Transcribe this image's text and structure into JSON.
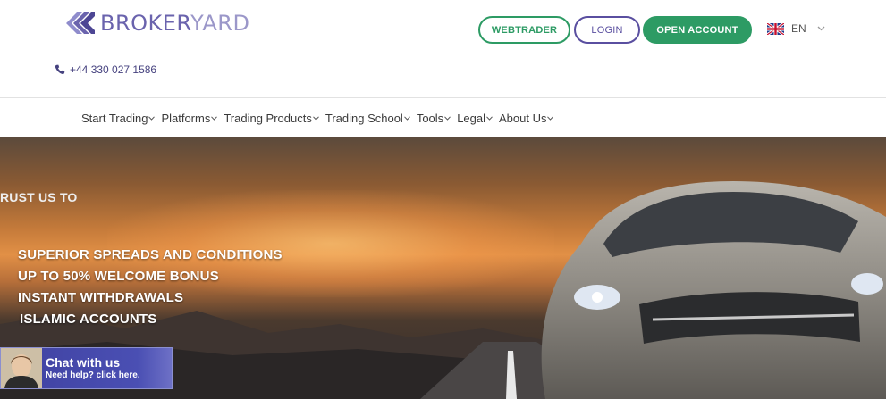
{
  "brand": {
    "name_part1": "BROKER",
    "name_part2": "YARD",
    "accent": "#6a63ad",
    "green": "#2d9b64"
  },
  "header": {
    "phone": "+44 330 027 1586",
    "buttons": {
      "webtrader": "WEBTRADER",
      "login": "LOGIN",
      "open_account": "OPEN ACCOUNT"
    },
    "language": "EN"
  },
  "nav": {
    "items": [
      {
        "label": "Start Trading"
      },
      {
        "label": "Platforms"
      },
      {
        "label": "Trading Products"
      },
      {
        "label": "Trading School"
      },
      {
        "label": "Tools"
      },
      {
        "label": "Legal"
      },
      {
        "label": "About Us"
      }
    ]
  },
  "hero": {
    "trust": "RUST US TO",
    "lines": [
      "SUPERIOR SPREADS AND CONDITIONS",
      "UP TO 50% WELCOME BONUS",
      "INSTANT WITHDRAWALS",
      "ISLAMIC ACCOUNTS"
    ]
  },
  "chat": {
    "title": "Chat with us",
    "subtitle": "Need help? click here."
  }
}
